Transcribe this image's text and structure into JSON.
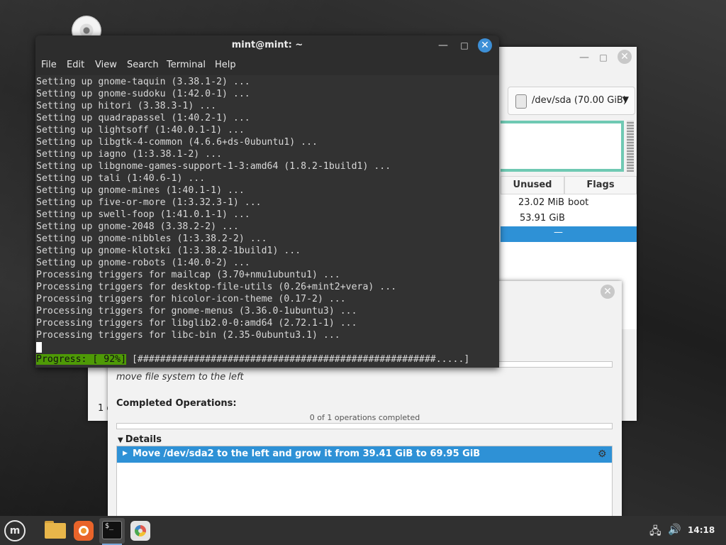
{
  "gparted": {
    "device": "/dev/sda (70.00 GiB)",
    "columns": [
      "Unused",
      "Flags"
    ],
    "rows": [
      {
        "unused": "23.02 MiB",
        "flags": "boot"
      },
      {
        "unused": "53.91 GiB",
        "flags": ""
      },
      {
        "unused": "—",
        "flags": ""
      }
    ],
    "status_partial": "1 o"
  },
  "apply_dialog": {
    "current_operation": "move file system to the left",
    "completed_label": "Completed Operations:",
    "completed_count": "0 of 1 operations completed",
    "details_label": "Details",
    "operation_row": "Move /dev/sda2 to the left and grow it from 39.41 GiB to 69.95 GiB"
  },
  "terminal": {
    "title": "mint@mint: ~",
    "menu": [
      "File",
      "Edit",
      "View",
      "Search",
      "Terminal",
      "Help"
    ],
    "lines": [
      "Setting up gnome-taquin (3.38.1-2) ...",
      "Setting up gnome-sudoku (1:42.0-1) ...",
      "Setting up hitori (3.38.3-1) ...",
      "Setting up quadrapassel (1:40.2-1) ...",
      "Setting up lightsoff (1:40.0.1-1) ...",
      "Setting up libgtk-4-common (4.6.6+ds-0ubuntu1) ...",
      "Setting up iagno (1:3.38.1-2) ...",
      "Setting up libgnome-games-support-1-3:amd64 (1.8.2-1build1) ...",
      "Setting up tali (1:40.6-1) ...",
      "Setting up gnome-mines (1:40.1-1) ...",
      "Setting up five-or-more (1:3.32.3-1) ...",
      "Setting up swell-foop (1:41.0.1-1) ...",
      "Setting up gnome-2048 (3.38.2-2) ...",
      "Setting up gnome-nibbles (1:3.38.2-2) ...",
      "Setting up gnome-klotski (1:3.38.2-1build1) ...",
      "Setting up gnome-robots (1:40.0-2) ...",
      "Processing triggers for mailcap (3.70+nmu1ubuntu1) ...",
      "Processing triggers for desktop-file-utils (0.26+mint2+vera) ...",
      "Processing triggers for hicolor-icon-theme (0.17-2) ...",
      "Processing triggers for gnome-menus (3.36.0-1ubuntu3) ...",
      "Processing triggers for libglib2.0-0:amd64 (2.72.1-1) ...",
      "Processing triggers for libc-bin (2.35-0ubuntu3.1) ..."
    ],
    "progress_label": "Progress: [ 92%]",
    "progress_bar": " [#####################################################.....]",
    "progress_percent": 92
  },
  "taskbar": {
    "clock": "14:18",
    "launchers": [
      "folder-icon",
      "firefox-icon",
      "terminal-icon",
      "gparted-icon"
    ]
  },
  "icons": {
    "close": "✕",
    "minimize": "—",
    "maximize": "□",
    "dropdown": "▼",
    "expanded": "▼",
    "collapsed": "▶",
    "gear": "⚙",
    "network": "🖧",
    "volume": "🔊"
  },
  "colors": {
    "selection": "#2e91d6",
    "progress_green": "#4e9a06",
    "terminal_bg": "#323232",
    "partition_border": "#6fc9b3"
  }
}
